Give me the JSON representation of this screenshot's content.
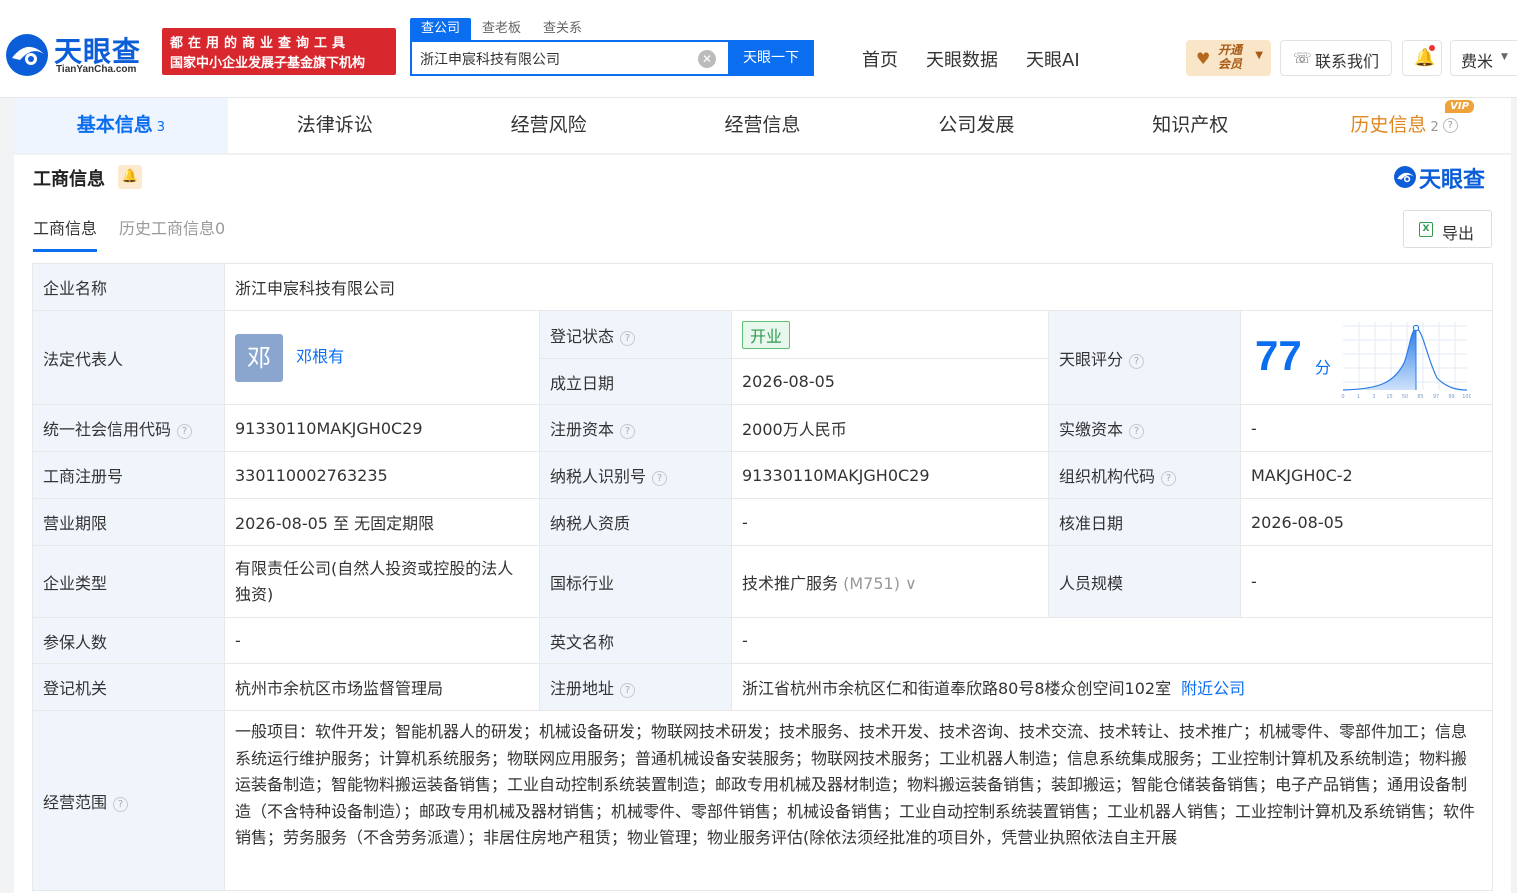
{
  "header": {
    "logo_text": "天眼查",
    "logo_sub": "TianYanCha.com",
    "slogan_line1": "都在用的商业查询工具",
    "slogan_line2": "国家中小企业发展子基金旗下机构",
    "search_tabs": [
      "查公司",
      "查老板",
      "查关系"
    ],
    "search_value": "浙江申宸科技有限公司",
    "search_button": "天眼一下",
    "nav": [
      "首页",
      "天眼数据",
      "天眼AI"
    ],
    "vip_label": "开通会员",
    "contact_label": "联系我们",
    "user_name": "费米"
  },
  "main_tabs": [
    {
      "label": "基本信息",
      "count": "3"
    },
    {
      "label": "法律诉讼"
    },
    {
      "label": "经营风险"
    },
    {
      "label": "经营信息"
    },
    {
      "label": "公司发展"
    },
    {
      "label": "知识产权"
    },
    {
      "label": "历史信息",
      "count": "2",
      "badge": "VIP"
    }
  ],
  "section": {
    "title": "工商信息",
    "brand": "天眼查",
    "sub_tabs": [
      "工商信息",
      "历史工商信息0"
    ],
    "export_label": "导出"
  },
  "info": {
    "company_name_label": "企业名称",
    "company_name": "浙江申宸科技有限公司",
    "legal_rep_label": "法定代表人",
    "legal_rep_avatar": "邓",
    "legal_rep": "邓根有",
    "reg_status_label": "登记状态",
    "reg_status": "开业",
    "found_date_label": "成立日期",
    "found_date": "2026-08-05",
    "score_label": "天眼评分",
    "score": "77",
    "score_unit": "分",
    "score_ticks": [
      "0",
      "1",
      "3",
      "15",
      "50",
      "85",
      "97",
      "99",
      "100"
    ],
    "credit_code_label": "统一社会信用代码",
    "credit_code": "91330110MAKJGH0C29",
    "reg_capital_label": "注册资本",
    "reg_capital": "2000万人民币",
    "paid_capital_label": "实缴资本",
    "paid_capital": "-",
    "reg_no_label": "工商注册号",
    "reg_no": "330110002763235",
    "taxpayer_id_label": "纳税人识别号",
    "taxpayer_id": "91330110MAKJGH0C29",
    "org_code_label": "组织机构代码",
    "org_code": "MAKJGH0C-2",
    "term_label": "营业期限",
    "term": "2026-08-05 至 无固定期限",
    "taxpayer_qual_label": "纳税人资质",
    "taxpayer_qual": "-",
    "approve_date_label": "核准日期",
    "approve_date": "2026-08-05",
    "company_type_label": "企业类型",
    "company_type": "有限责任公司(自然人投资或控股的法人独资)",
    "industry_label": "国标行业",
    "industry": "技术推广服务",
    "industry_code": "(M751)",
    "staff_size_label": "人员规模",
    "staff_size": "-",
    "insured_label": "参保人数",
    "insured": "-",
    "english_name_label": "英文名称",
    "english_name": "-",
    "reg_authority_label": "登记机关",
    "reg_authority": "杭州市余杭区市场监督管理局",
    "reg_address_label": "注册地址",
    "reg_address": "浙江省杭州市余杭区仁和街道奉欣路80号8楼众创空间102室",
    "nearby_label": "附近公司",
    "scope_label": "经营范围",
    "scope": "一般项目：软件开发；智能机器人的研发；机械设备研发；物联网技术研发；技术服务、技术开发、技术咨询、技术交流、技术转让、技术推广；机械零件、零部件加工；信息系统运行维护服务；计算机系统服务；物联网应用服务；普通机械设备安装服务；物联网技术服务；工业机器人制造；信息系统集成服务；工业控制计算机及系统制造；物料搬运装备制造；智能物料搬运装备销售；工业自动控制系统装置制造；邮政专用机械及器材制造；物料搬运装备销售；装卸搬运；智能仓储装备销售；电子产品销售；通用设备制造（不含特种设备制造）；邮政专用机械及器材销售；机械零件、零部件销售；机械设备销售；工业自动控制系统装置销售；工业机器人销售；工业控制计算机及系统销售；软件销售；劳务服务（不含劳务派遣）；非居住房地产租赁；物业管理；物业服务评估(除依法须经批准的项目外，凭营业执照依法自主开展"
  }
}
